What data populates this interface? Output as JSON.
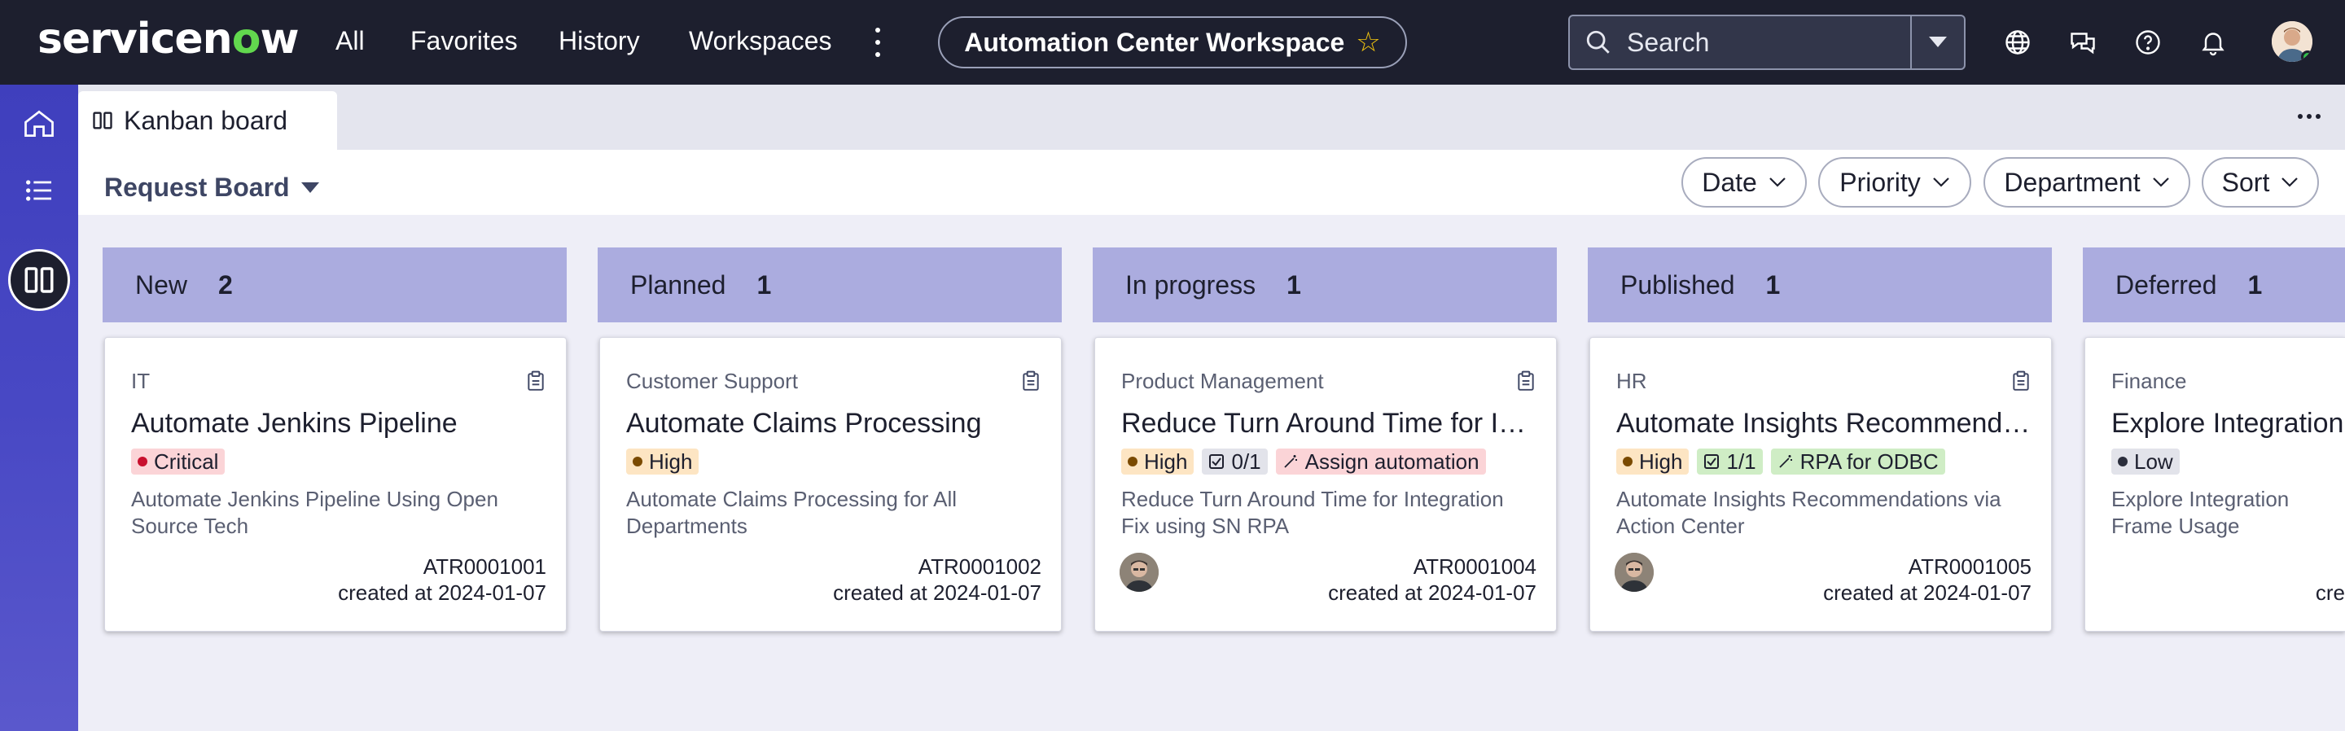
{
  "nav": {
    "logo_pre": "servicen",
    "logo_o": "o",
    "logo_post": "w",
    "items": [
      "All",
      "Favorites",
      "History",
      "Workspaces"
    ],
    "workspace": "Automation Center Workspace",
    "search_placeholder": "Search"
  },
  "tab": {
    "label": "Kanban board"
  },
  "board": {
    "title": "Request Board",
    "filters": [
      "Date",
      "Priority",
      "Department",
      "Sort"
    ]
  },
  "columns": [
    {
      "name": "New",
      "count": "2"
    },
    {
      "name": "Planned",
      "count": "1"
    },
    {
      "name": "In progress",
      "count": "1"
    },
    {
      "name": "Published",
      "count": "1"
    },
    {
      "name": "Deferred",
      "count": "1"
    }
  ],
  "cards": [
    {
      "dept": "IT",
      "title": "Automate Jenkins Pipeline",
      "priority": "Critical",
      "desc": "Automate Jenkins Pipeline Using Open Source Tech",
      "number": "ATR0001001",
      "created": "created at 2024-01-07"
    },
    {
      "dept": "Customer Support",
      "title": "Automate Claims Processing",
      "priority": "High",
      "desc": "Automate Claims Processing for All Departments",
      "number": "ATR0001002",
      "created": "created at 2024-01-07"
    },
    {
      "dept": "Product Management",
      "title": "Reduce Turn Around Time for Inte…",
      "priority": "High",
      "checklist": "0/1",
      "automation": "Assign automation",
      "desc": "Reduce Turn Around Time for Integration Fix using SN RPA",
      "number": "ATR0001004",
      "created": "created at 2024-01-07"
    },
    {
      "dept": "HR",
      "title": "Automate Insights Recommendati…",
      "priority": "High",
      "checklist": "1/1",
      "automation": "RPA for ODBC",
      "desc": "Automate Insights Recommendations via Action Center",
      "number": "ATR0001005",
      "created": "created at 2024-01-07"
    },
    {
      "dept": "Finance",
      "title": "Explore Integration F",
      "priority": "Low",
      "desc": "Explore Integration Frame Usage",
      "created": "cre"
    }
  ],
  "colors": {
    "navbar": "#1d1f2e",
    "rail": "#4343c0",
    "column_header": "#abacdf",
    "board_bg": "#eeeef7",
    "critical": "#fbd4d7",
    "high": "#fde5c3",
    "low": "#e2e3ea",
    "success": "#cfedc5"
  },
  "icons": [
    "search-icon",
    "chevron-down-icon",
    "globe-icon",
    "chat-icon",
    "help-icon",
    "bell-icon",
    "home-icon",
    "list-icon",
    "kanban-icon",
    "clipboard-icon",
    "star-icon"
  ]
}
